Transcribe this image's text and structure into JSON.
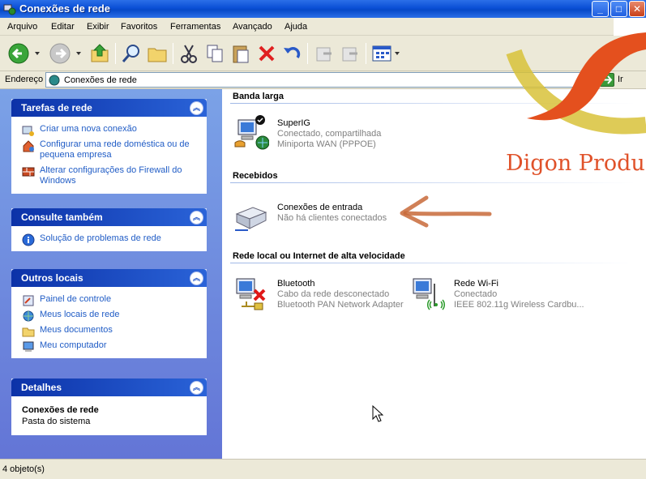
{
  "window": {
    "title": "Conexões de rede"
  },
  "menu": [
    "Arquivo",
    "Editar",
    "Exibir",
    "Favoritos",
    "Ferramentas",
    "Avançado",
    "Ajuda"
  ],
  "address": {
    "label": "Endereço",
    "value": "Conexões de rede",
    "go_label": "Ir"
  },
  "taskpane": {
    "network_tasks": {
      "title": "Tarefas de rede",
      "items": [
        "Criar uma nova conexão",
        "Configurar uma rede doméstica ou de pequena empresa",
        "Alterar configurações do Firewall do Windows"
      ]
    },
    "see_also": {
      "title": "Consulte também",
      "items": [
        "Solução de problemas de rede"
      ]
    },
    "other_places": {
      "title": "Outros locais",
      "items": [
        "Painel de controle",
        "Meus locais de rede",
        "Meus documentos",
        "Meu computador"
      ]
    },
    "details": {
      "title": "Detalhes",
      "name": "Conexões de rede",
      "type": "Pasta do sistema"
    }
  },
  "content": {
    "groups": [
      {
        "title": "Banda larga"
      },
      {
        "title": "Recebidos"
      },
      {
        "title": "Rede local ou Internet de alta velocidade"
      }
    ],
    "connections": {
      "superig": {
        "name": "SuperIG",
        "status": "Conectado, compartilhada",
        "device": "Miniporta WAN (PPPOE)"
      },
      "incoming": {
        "name": "Conexões de entrada",
        "status": "Não há clientes conectados"
      },
      "bluetooth": {
        "name": "Bluetooth",
        "status": "Cabo da rede desconectado",
        "device": "Bluetooth PAN Network Adapter"
      },
      "wifi": {
        "name": "Rede Wi-Fi",
        "status": "Conectado",
        "device": "IEEE 802.11g Wireless Cardbu..."
      }
    }
  },
  "status_bar": {
    "text": "4 objeto(s)"
  },
  "watermark": {
    "text": "Digon Produ"
  },
  "colors": {
    "taskpane_bg": "#6f8ee0",
    "link": "#215dc6",
    "title_bar": "#0a4fd6",
    "watermark": "#e0522a"
  }
}
